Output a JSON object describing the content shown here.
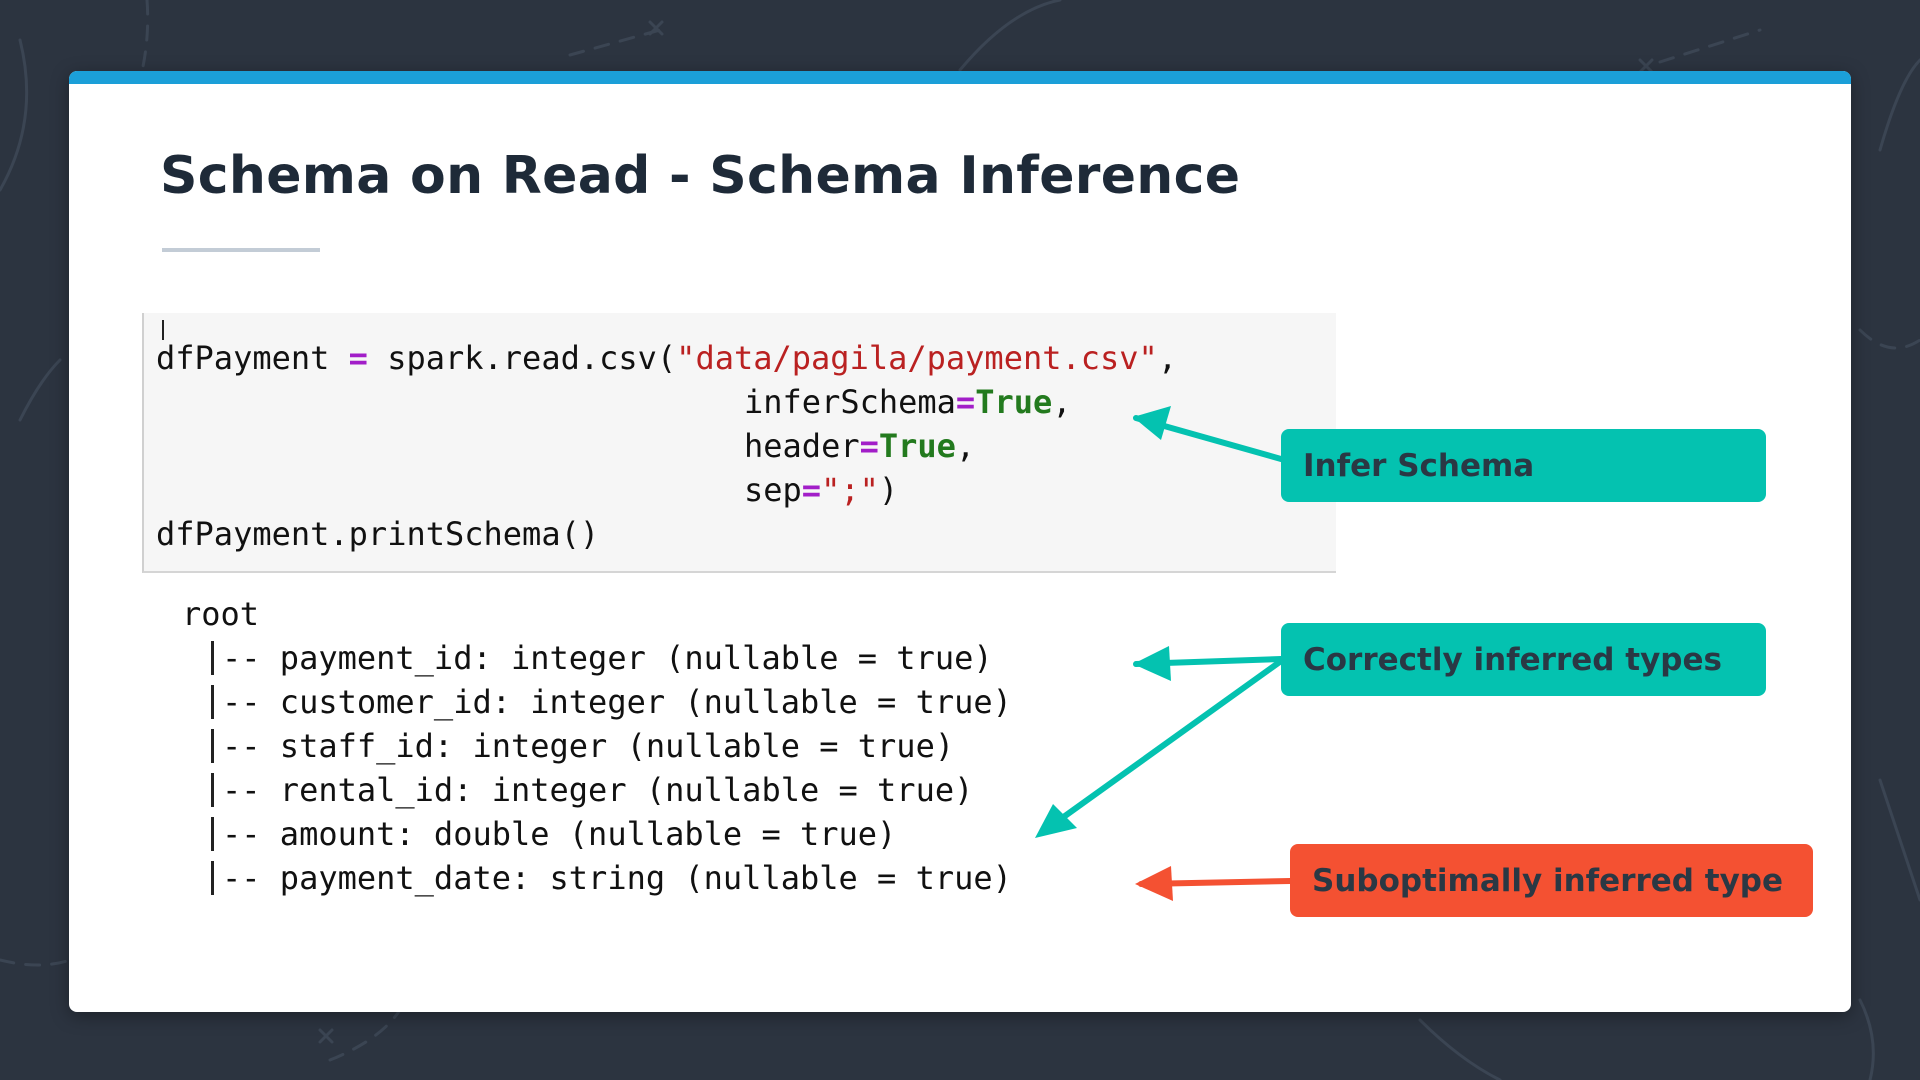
{
  "slide": {
    "title": "Schema on Read - Schema Inference"
  },
  "code_cell": {
    "lines": [
      {
        "var": "dfPayment ",
        "op": "=",
        "call": " spark.read.csv(",
        "str": "\"data/pagila/payment.csv\"",
        "tail": ","
      },
      {
        "key": "inferSchema",
        "op": "=",
        "kw": "True",
        "tail": ","
      },
      {
        "key": "header",
        "op": "=",
        "kw": "True",
        "tail": ","
      },
      {
        "key": "sep",
        "op": "=",
        "str": "\";\"",
        "tail": ")"
      },
      {
        "text": "dfPayment.printSchema()"
      }
    ]
  },
  "schema_output": {
    "root": "root",
    "fields": [
      "-- payment_id: integer (nullable = true)",
      "-- customer_id: integer (nullable = true)",
      "-- staff_id: integer (nullable = true)",
      "-- rental_id: integer (nullable = true)",
      "-- amount: double (nullable = true)",
      "-- payment_date: string (nullable = true)"
    ]
  },
  "callouts": {
    "infer_schema": "Infer Schema",
    "correct_types": "Correctly inferred types",
    "suboptimal_type": "Suboptimally inferred type"
  },
  "colors": {
    "background": "#2c3440",
    "accent_bar": "#1b9fd8",
    "teal": "#04c2b0",
    "orange": "#f45132",
    "title": "#1e2a38"
  }
}
